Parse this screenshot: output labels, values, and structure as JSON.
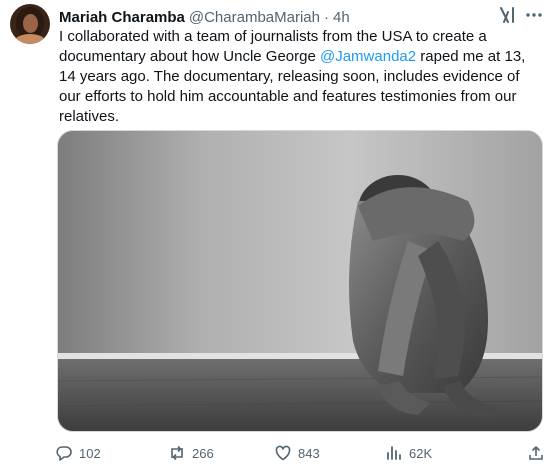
{
  "author": {
    "name": "Mariah Charamba",
    "handle": "@CharambaMariah",
    "separator": "·",
    "time": "4h"
  },
  "tweet": {
    "text_before_mention": "I collaborated with a team of journalists from the USA to create a documentary about how Uncle George ",
    "mention": "@Jamwanda2",
    "text_after_mention": " raped me at 13, 14 years ago. The documentary, releasing soon, includes evidence of our efforts to hold him accountable and features testimonies from our relatives."
  },
  "actions": {
    "replies": "102",
    "reposts": "266",
    "likes": "843",
    "views": "62K"
  },
  "icons": {
    "top_right": [
      "grok-icon",
      "more-icon"
    ],
    "actions": [
      "reply-icon",
      "repost-icon",
      "like-icon",
      "views-icon",
      "share-icon"
    ]
  },
  "colors": {
    "text": "#0f1419",
    "muted": "#536471",
    "link": "#1d9bf0",
    "border": "#cfd9de"
  }
}
